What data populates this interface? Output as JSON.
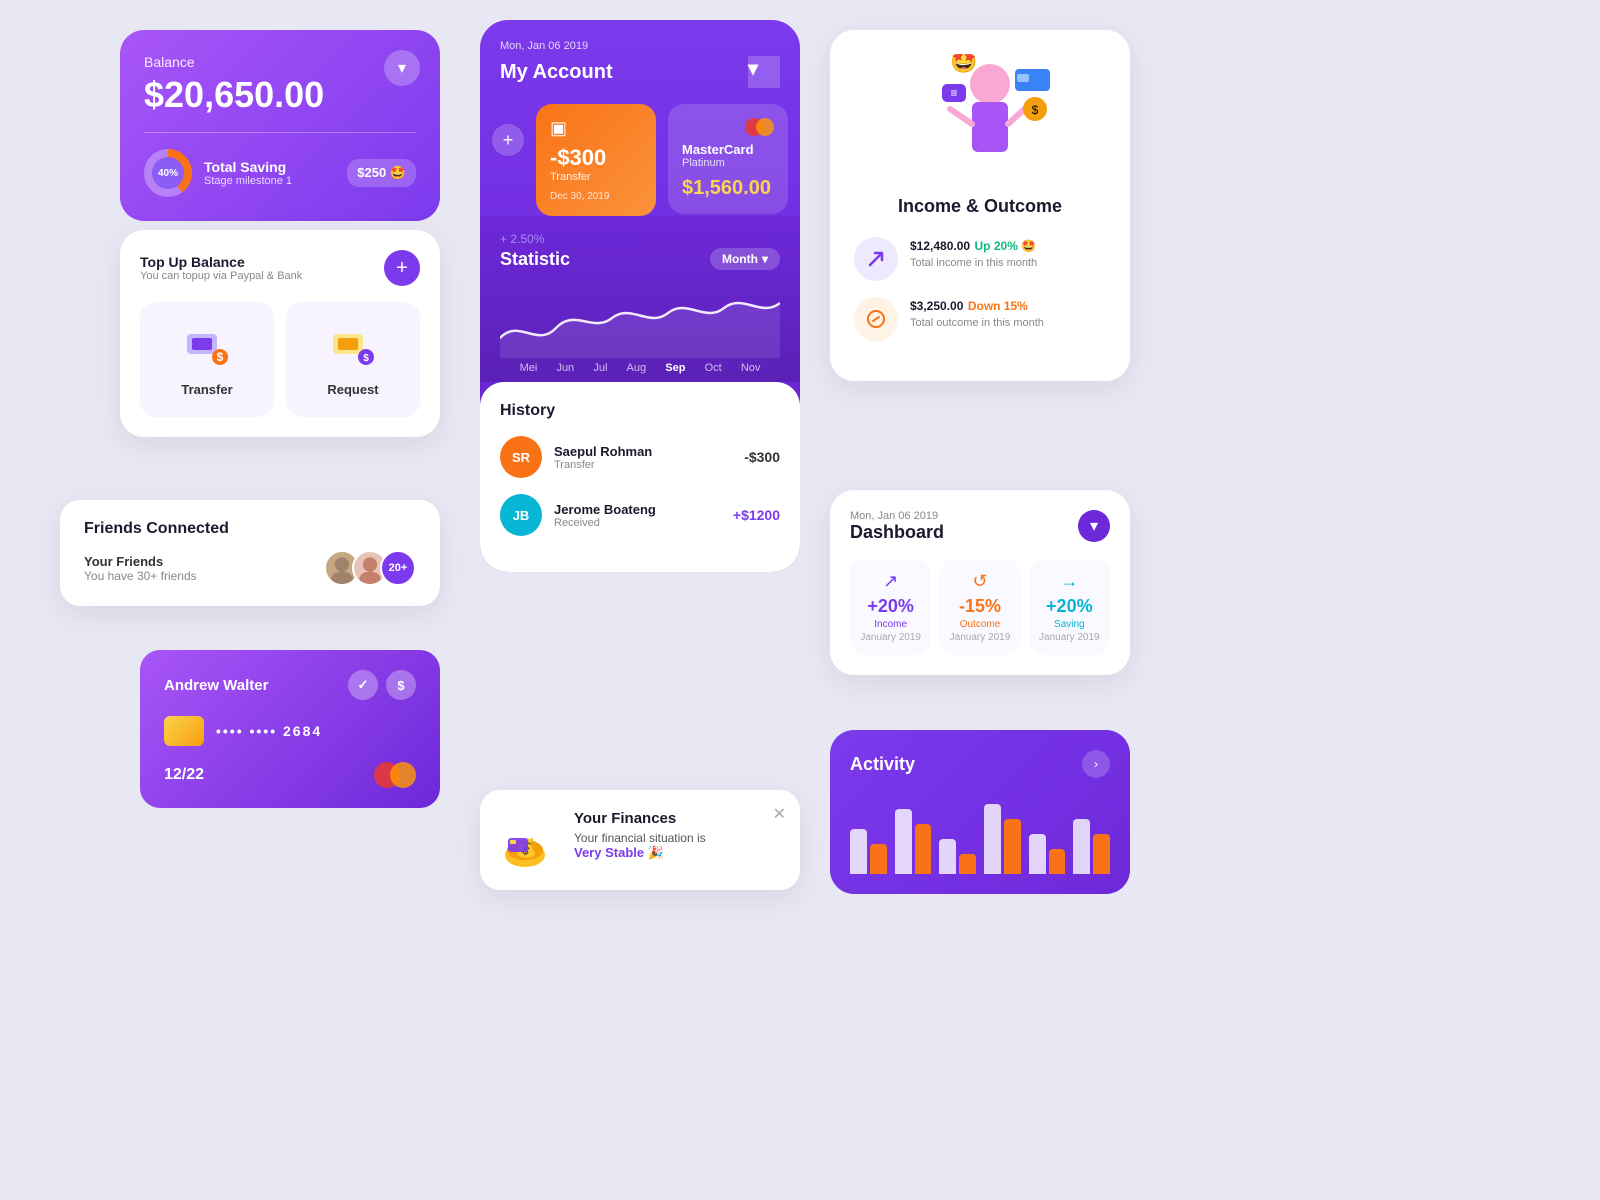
{
  "balance": {
    "label": "Balance",
    "amount": "$20,650.00",
    "donut_pct": "40%",
    "saving_title": "Total Saving",
    "saving_sub": "Stage milestone 1",
    "saving_amount": "$250 🤩",
    "topup_title": "Top Up Balance",
    "topup_sub": "You can topup via Paypal & Bank",
    "transfer_label": "Transfer",
    "request_label": "Request"
  },
  "friends": {
    "section_title": "Friends Connected",
    "label": "Your Friends",
    "sub": "You have 30+ friends",
    "count": "20+"
  },
  "credit_card": {
    "name": "Andrew Walter",
    "number": "•••• ••••  2684",
    "expiry": "12/22"
  },
  "account": {
    "date": "Mon, Jan 06 2019",
    "title": "My Account",
    "transfer_amount": "-$300",
    "transfer_label": "Transfer",
    "transfer_date": "Dec 30, 2019",
    "mastercard_name": "MasterCard",
    "mastercard_type": "Platinum",
    "mastercard_amount": "$1,560.00",
    "stat_pct": "+ 2.50%",
    "stat_title": "Statistic",
    "month_btn": "Month",
    "wave_labels": [
      "Mei",
      "Jun",
      "Jul",
      "Aug",
      "Sep",
      "Oct",
      "Nov"
    ],
    "wave_active": "Sep",
    "history_title": "History",
    "history": [
      {
        "initials": "SR",
        "name": "Saepul Rohman",
        "type": "Transfer",
        "amount": "-$300",
        "positive": false,
        "bg": "#f97316"
      },
      {
        "initials": "JB",
        "name": "Jerome Boateng",
        "type": "Received",
        "amount": "+$1200",
        "positive": true,
        "bg": "#06b6d4"
      }
    ]
  },
  "finances": {
    "title": "Your Finances",
    "sub": "Your financial situation is",
    "status": "Very Stable 🎉"
  },
  "income": {
    "title": "Income & Outcome",
    "income_amount": "$12,480.00",
    "income_badge": "Up 20% 🤩",
    "income_label": "Total income in this month",
    "outcome_amount": "$3,250.00",
    "outcome_badge": "Down 15%",
    "outcome_label": "Total outcome in this month"
  },
  "dashboard": {
    "date": "Mon, Jan 06 2019",
    "title": "Dashboard",
    "stats": [
      {
        "icon": "↗",
        "value": "+20%",
        "label": "Income",
        "month": "January 2019",
        "type": "income"
      },
      {
        "icon": "↺",
        "value": "-15%",
        "label": "Outcome",
        "month": "January 2019",
        "type": "outcome"
      },
      {
        "icon": "→",
        "value": "+20%",
        "label": "Saving",
        "month": "January 2019",
        "type": "saving"
      }
    ]
  },
  "activity": {
    "title": "Activity",
    "bars": [
      {
        "white": 45,
        "orange": 30
      },
      {
        "white": 65,
        "orange": 50
      },
      {
        "white": 35,
        "orange": 20
      },
      {
        "white": 70,
        "orange": 55
      },
      {
        "white": 40,
        "orange": 25
      },
      {
        "white": 55,
        "orange": 40
      }
    ]
  }
}
